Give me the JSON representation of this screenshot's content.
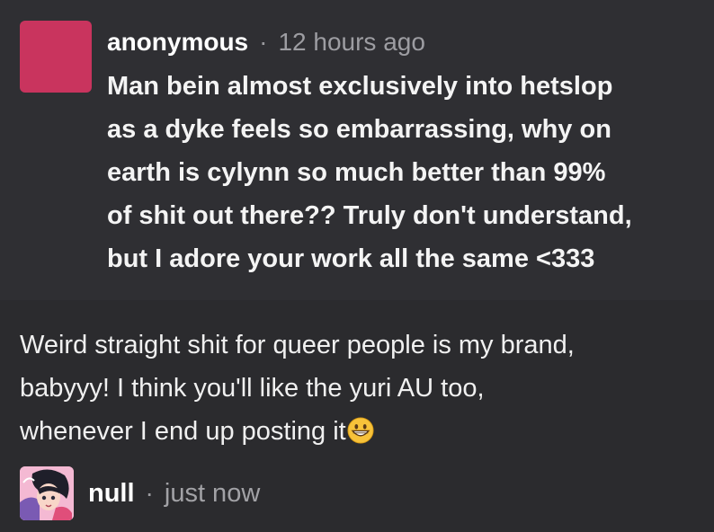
{
  "ask": {
    "author": "anonymous",
    "separator": "·",
    "time": "12 hours ago",
    "body": "Man bein almost exclusively into hetslop\nas a dyke feels so embarrassing, why on\nearth is cylynn so much better than 99%\nof shit out there?? Truly don't understand,\nbut I adore your work all the same <333",
    "avatar_color": "#c9345e"
  },
  "answer": {
    "body": "Weird straight shit for queer people is my brand,\nbabyyy! I think you'll like the yuri AU too,\nwhenever I end up posting it",
    "emoji": "grinning-face-icon"
  },
  "answerer": {
    "name": "null",
    "separator": "·",
    "time": "just now",
    "avatar_accent": "#f3b6d2"
  },
  "colors": {
    "page_background": "#2b2b2e",
    "ask_background": "#2f2f33",
    "secondary_text": "#9d9da2"
  }
}
